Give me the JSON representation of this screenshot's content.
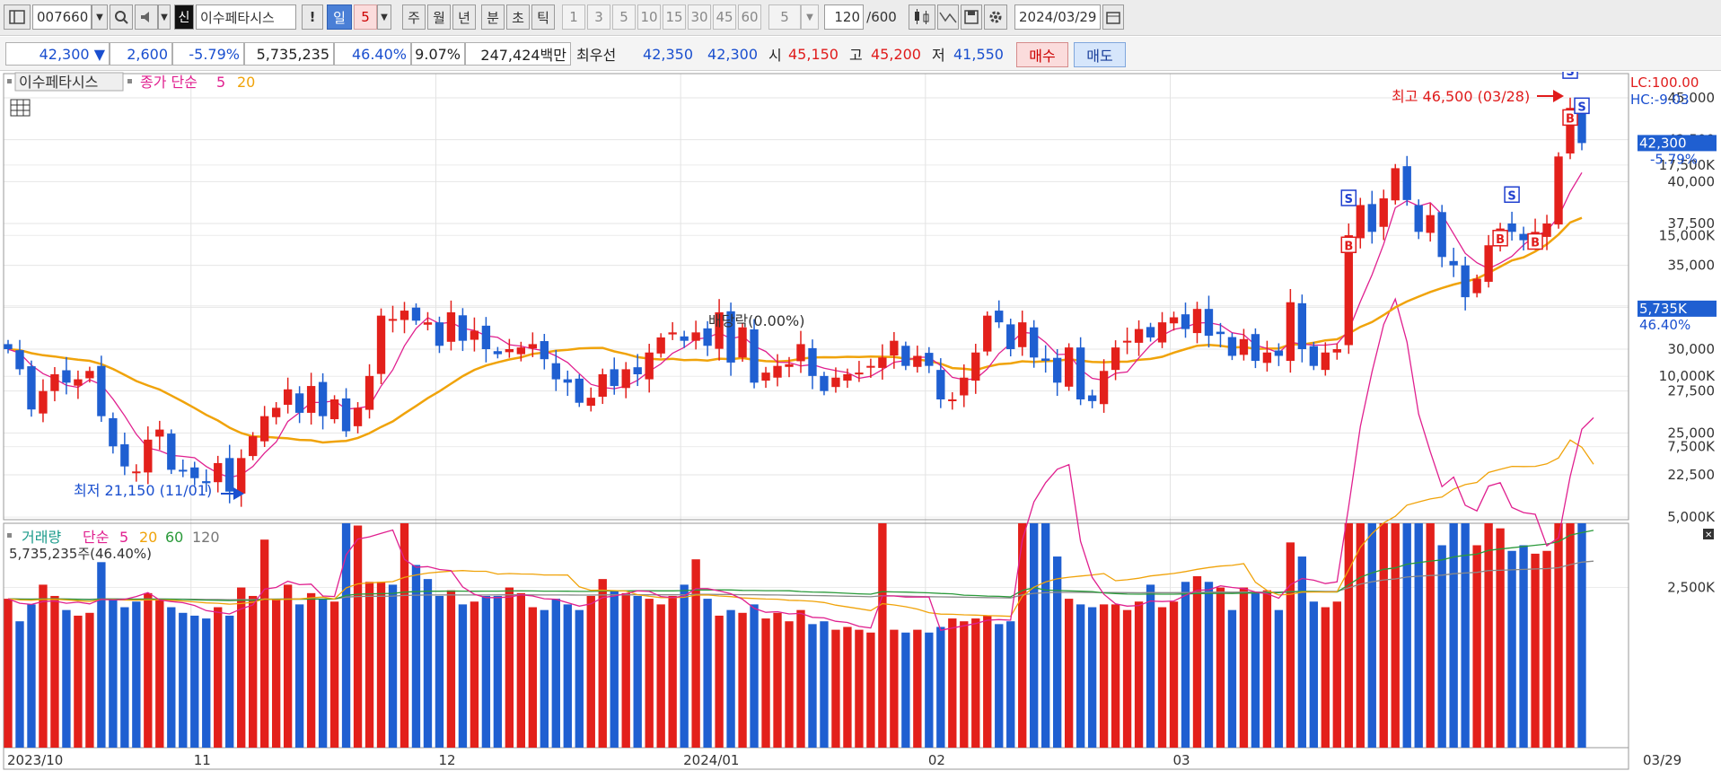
{
  "toolbar": {
    "stock_code": "007660",
    "badge": "신",
    "stock_name": "이수페타시스",
    "excl": "!",
    "periods": [
      "일",
      "5",
      "주",
      "월",
      "년",
      "분",
      "초",
      "틱"
    ],
    "minute_intervals": [
      "1",
      "3",
      "5",
      "10",
      "15",
      "30",
      "45",
      "60"
    ],
    "interval_select": "5",
    "count": "120",
    "count_max": "/600",
    "date": "2024/03/29"
  },
  "info": {
    "price": "42,300",
    "change": "2,600",
    "change_pct": "-5.79%",
    "volume": "5,735,235",
    "volume_ratio": "46.40%",
    "turnover": "9.07%",
    "trade_value": "247,424백만",
    "best_label": "최우선",
    "best_ask": "42,350",
    "best_bid": "42,300",
    "open_label": "시",
    "open": "45,150",
    "high_label": "고",
    "high": "45,200",
    "low_label": "저",
    "low": "41,550",
    "buy": "매수",
    "sell": "매도"
  },
  "price_legend": {
    "name": "이수페타시스",
    "ma_label": "종가 단순",
    "ma5": "5",
    "ma20": "20"
  },
  "volume_legend": {
    "name": "거래량",
    "ma_label": "단순",
    "ma5": "5",
    "ma20": "20",
    "ma60": "60",
    "ma120": "120",
    "current": "5,735,235주(46.40%)"
  },
  "right_labels": {
    "lc": "LC:100.00",
    "hc": "HC:-9.03",
    "price_tag": "42,300",
    "pct_tag": "-5.79%",
    "vol_tag": "5,735K",
    "vol_pct_tag": "46.40%"
  },
  "annotations": {
    "high": "최고 46,500 (03/28)",
    "low": "최저 21,150 (11/01)",
    "dividend": "배당락(0.00%)"
  },
  "colors": {
    "up": "#e3201b",
    "down": "#1f5fd1",
    "ma5": "#e0208f",
    "ma20": "#f0a30a",
    "ma60": "#2a9a3a",
    "ma120": "#8a8a8a"
  },
  "chart_data": [
    {
      "type": "candlestick",
      "ylim": [
        19500,
        47500
      ],
      "yticks": [
        "22,500",
        "25,000",
        "27,500",
        "30,000",
        "32,500",
        "35,000",
        "37,500",
        "40,000",
        "42,500",
        "45,000"
      ],
      "x_labels": [
        "2023/10",
        "11",
        "12",
        "2024/01",
        "02",
        "03",
        "03/29"
      ],
      "series": [
        {
          "name": "종가",
          "values": [
            30000,
            28800,
            26400,
            27500,
            28500,
            28000,
            28200,
            28700,
            26000,
            24200,
            23000,
            22700,
            24600,
            25200,
            22800,
            22700,
            22300,
            22000,
            23200,
            21500,
            23500,
            24800,
            26000,
            26500,
            27600,
            26200,
            27800,
            26000,
            27000,
            25100,
            26500,
            28400,
            32000,
            31800,
            32300,
            31700,
            31600,
            30200,
            32200,
            30500,
            31100,
            30000,
            29700,
            30000,
            30100,
            30300,
            29400,
            28200,
            28000,
            26800,
            27100,
            28500,
            27800,
            28800,
            28500,
            29800,
            30700,
            31000,
            30500,
            31000,
            30200,
            32200,
            29200,
            31300,
            28000,
            28600,
            29000,
            29100,
            30300,
            28400,
            27500,
            28300,
            28500,
            28600,
            29000,
            29500,
            30500,
            29000,
            29600,
            29000,
            27000,
            27000,
            28300,
            29800,
            32000,
            31600,
            30000,
            31600,
            29500,
            29300,
            28000,
            30100,
            27000,
            26900,
            28700,
            30100,
            30500,
            31200,
            30700,
            31600,
            31900,
            31200,
            32400,
            30800,
            30900,
            29600,
            30600,
            29300,
            29800,
            29600,
            32800,
            30000,
            29000,
            29800,
            30000,
            36800,
            38600,
            37000,
            39000,
            40800,
            38900,
            37000,
            38000,
            35500,
            35000,
            33100,
            34200,
            36200,
            37200,
            37000,
            36500,
            37000,
            37500,
            41500,
            44400,
            42300
          ]
        }
      ]
    },
    {
      "type": "bar",
      "title": "거래량",
      "ylim": [
        0,
        18500
      ],
      "yticks": [
        "2,500K",
        "5,000K",
        "7,500K",
        "10,000K",
        "12,500K",
        "15,000K",
        "17,500K"
      ],
      "series": [
        {
          "name": "거래량",
          "values": [
            2100,
            1300,
            1900,
            2600,
            2200,
            1700,
            1500,
            1600,
            3400,
            2100,
            1800,
            2000,
            2300,
            2100,
            1800,
            1600,
            1500,
            1400,
            1800,
            1500,
            2500,
            2200,
            4200,
            2100,
            2600,
            1900,
            2300,
            2100,
            2000,
            10000,
            4700,
            2700,
            2700,
            2600,
            4800,
            3300,
            2800,
            2200,
            2400,
            1900,
            2000,
            2200,
            2200,
            2500,
            2300,
            1800,
            1700,
            2100,
            1900,
            1700,
            2200,
            2800,
            2400,
            2300,
            2200,
            2100,
            1900,
            2200,
            2600,
            3500,
            2100,
            1500,
            1700,
            1600,
            1900,
            1400,
            1600,
            1300,
            1700,
            1200,
            1300,
            1000,
            1100,
            1000,
            900,
            7000,
            1000,
            900,
            1000,
            900,
            1100,
            1400,
            1300,
            1400,
            1500,
            1200,
            1300,
            15500,
            8200,
            4900,
            3600,
            2100,
            1900,
            1800,
            1900,
            1900,
            1700,
            2000,
            2600,
            1800,
            2000,
            2700,
            2900,
            2700,
            2500,
            1700,
            2500,
            2300,
            2400,
            1700,
            4100,
            3600,
            2000,
            1800,
            2000,
            17500,
            17800,
            11700,
            10200,
            6500,
            9900,
            5000,
            5000,
            4000,
            8200,
            4900,
            4000,
            9400,
            4600,
            3800,
            4000,
            3700,
            3800,
            6000,
            14700,
            12400,
            5735
          ]
        },
        {
          "name": "5",
          "values": []
        },
        {
          "name": "20",
          "values": []
        },
        {
          "name": "60",
          "values": []
        },
        {
          "name": "120",
          "values": []
        }
      ]
    }
  ]
}
